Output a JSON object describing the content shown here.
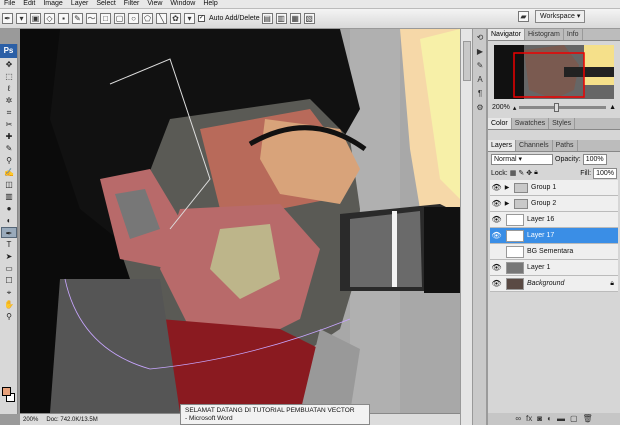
{
  "menu": [
    "File",
    "Edit",
    "Image",
    "Layer",
    "Select",
    "Filter",
    "View",
    "Window",
    "Help"
  ],
  "options": {
    "auto_add_delete": "Auto Add/Delete",
    "icons": [
      "pen-tool-icon",
      "path-icon",
      "rect-shape-icon",
      "rounded-rect-icon",
      "ellipse-icon",
      "polygon-icon",
      "line-icon",
      "custom-shape-icon"
    ]
  },
  "workspace_label": "Workspace",
  "toolbox": {
    "ps_badge": "Ps",
    "tools": [
      "move-tool",
      "marquee-tool",
      "lasso-tool",
      "magic-wand-tool",
      "crop-tool",
      "slice-tool",
      "healing-tool",
      "brush-tool",
      "stamp-tool",
      "history-brush-tool",
      "eraser-tool",
      "gradient-tool",
      "blur-tool",
      "dodge-tool",
      "pen-tool",
      "type-tool",
      "path-select-tool",
      "shape-tool",
      "notes-tool",
      "eyedropper-tool",
      "hand-tool",
      "zoom-tool"
    ],
    "tool_glyphs": [
      "✥",
      "⬚",
      "ℓ",
      "✲",
      "⌗",
      "✂",
      "✚",
      "✎",
      "⚲",
      "✍",
      "◫",
      "▥",
      "●",
      "◐",
      "✒",
      "T",
      "➤",
      "▭",
      "☐",
      "⌖",
      "✋",
      "⚲"
    ],
    "selected_index": 14,
    "fg_color": "#e8a27c",
    "bg_color": "#ffffff"
  },
  "status": {
    "zoom": "200%",
    "doc": "Doc: 742.0K/13.5M"
  },
  "taskbar_popup": {
    "line1": "SELAMAT DATANG DI TUTORIAL PEMBUATAN VECTOR",
    "line2": "- Microsoft Word"
  },
  "navigator": {
    "tabs": [
      "Navigator",
      "Histogram",
      "Info"
    ],
    "zoom": "200%"
  },
  "color_panel": {
    "tabs": [
      "Color",
      "Swatches",
      "Styles"
    ]
  },
  "layers_panel": {
    "tabs": [
      "Layers",
      "Channels",
      "Paths"
    ],
    "blend_mode": "Normal",
    "opacity_label": "Opacity:",
    "opacity": "100%",
    "lock_label": "Lock:",
    "fill_label": "Fill:",
    "fill": "100%",
    "layers": [
      {
        "name": "Group 1",
        "type": "group",
        "visible": true,
        "selected": false
      },
      {
        "name": "Group 2",
        "type": "group",
        "visible": true,
        "selected": false
      },
      {
        "name": "Layer 16",
        "type": "layer",
        "visible": true,
        "selected": false
      },
      {
        "name": "Layer 17",
        "type": "layer",
        "visible": true,
        "selected": true
      },
      {
        "name": "BG Sementara",
        "type": "layer",
        "visible": false,
        "selected": false
      },
      {
        "name": "Layer 1",
        "type": "layer",
        "visible": true,
        "selected": false
      },
      {
        "name": "Background",
        "type": "background",
        "visible": true,
        "selected": false
      }
    ]
  }
}
